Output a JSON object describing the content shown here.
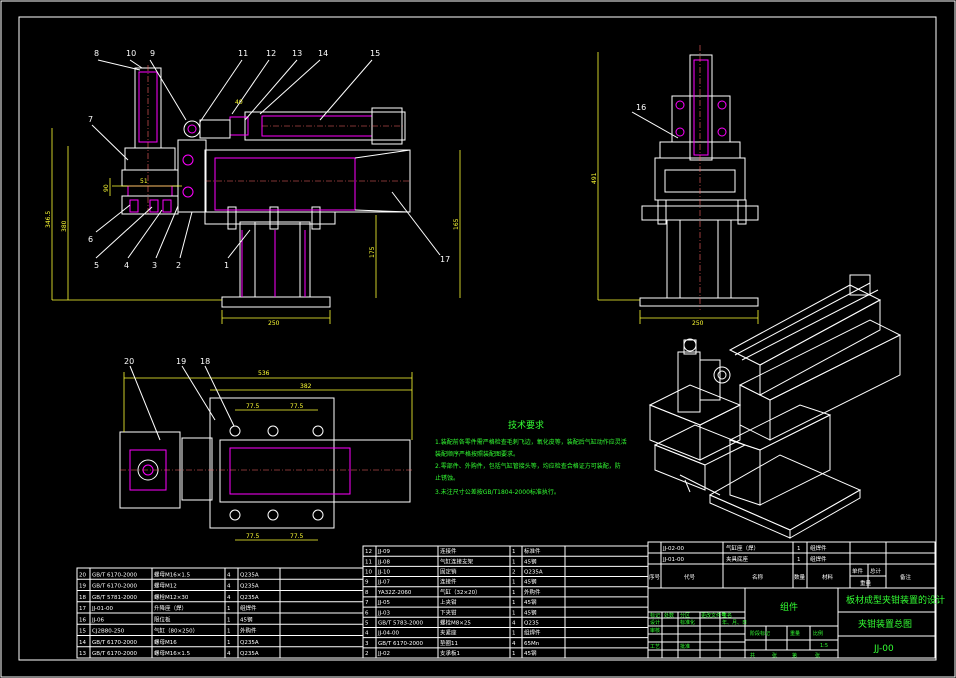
{
  "views": {
    "front": {
      "callouts": [
        "8",
        "10",
        "9",
        "11",
        "12",
        "13",
        "14",
        "15",
        "7",
        "6",
        "5",
        "4",
        "3",
        "2",
        "1",
        "17"
      ],
      "dims": {
        "h_overall": "346.5",
        "h_left": "380",
        "w_small": "90",
        "w_small2": "51",
        "h_right": "175",
        "h_right2": "165",
        "w_base": "250",
        "w_top": "40"
      }
    },
    "side": {
      "callouts": [
        "16"
      ],
      "dims": {
        "h": "491",
        "w": "250"
      }
    },
    "top": {
      "callouts": [
        "20",
        "19",
        "18"
      ],
      "dims": {
        "overall": "536",
        "inner": "382",
        "sp1": "77.5",
        "sp2": "77.5",
        "sp3": "77.5",
        "sp4": "77.5"
      }
    }
  },
  "notes": {
    "title": "技术要求",
    "lines": [
      "1.装配前各零件需严格检查毛刺飞边，氧化皮等，装配后气缸动作应灵活",
      "  装配顺序严格按照装配图要求。",
      "2.零部件、外购件，包括气缸管接头等，均应检查合格证方可装配，防",
      "  止锈蚀。",
      "3.未注尺寸公差按GB/T1804-2000标准执行。"
    ]
  },
  "parts_left": [
    {
      "no": "20",
      "code": "GB/T 6170-2000",
      "name": "螺母M16×1.5",
      "qty": "4",
      "mat": "Q235A"
    },
    {
      "no": "19",
      "code": "GB/T 6170-2000",
      "name": "螺母M12",
      "qty": "4",
      "mat": "Q235A"
    },
    {
      "no": "18",
      "code": "GB/T 5781-2000",
      "name": "螺栓M12×30",
      "qty": "4",
      "mat": "Q235A"
    },
    {
      "no": "17",
      "code": "JJ-01-00",
      "name": "升降座（焊）",
      "qty": "1",
      "mat": "组焊件"
    },
    {
      "no": "16",
      "code": "JJ-06",
      "name": "限位板",
      "qty": "1",
      "mat": "45钢"
    },
    {
      "no": "15",
      "code": "CJ2B80-250",
      "name": "气缸（80×250）",
      "qty": "1",
      "mat": "外购件"
    },
    {
      "no": "14",
      "code": "GB/T 6170-2000",
      "name": "螺母M16",
      "qty": "1",
      "mat": "Q235A"
    },
    {
      "no": "13",
      "code": "GB/T 6170-2000",
      "name": "螺母M16×1.5",
      "qty": "4",
      "mat": "Q235A"
    }
  ],
  "parts_mid": [
    {
      "no": "12",
      "code": "JJ-09",
      "name": "连接件",
      "qty": "1",
      "mat": "标准件"
    },
    {
      "no": "11",
      "code": "JJ-08",
      "name": "气缸连接支架",
      "qty": "1",
      "mat": "45钢"
    },
    {
      "no": "10",
      "code": "JJ-10",
      "name": "固定销",
      "qty": "2",
      "mat": "Q235A"
    },
    {
      "no": "9",
      "code": "JJ-07",
      "name": "连接件",
      "qty": "1",
      "mat": "45钢"
    },
    {
      "no": "8",
      "code": "YA32Z-2060",
      "name": "气缸（32×20）",
      "qty": "1",
      "mat": "外购件"
    },
    {
      "no": "7",
      "code": "JJ-05",
      "name": "上夹钳",
      "qty": "1",
      "mat": "45钢"
    },
    {
      "no": "6",
      "code": "JJ-03",
      "name": "下夹钳",
      "qty": "1",
      "mat": "45钢"
    },
    {
      "no": "5",
      "code": "GB/T 5783-2000",
      "name": "螺栓M8×25",
      "qty": "4",
      "mat": "Q235"
    },
    {
      "no": "4",
      "code": "JJ-04-00",
      "name": "夹紧座",
      "qty": "1",
      "mat": "组焊件"
    },
    {
      "no": "3",
      "code": "GB/T 6170-2000",
      "name": "垫圈11",
      "qty": "4",
      "mat": "65Mn"
    },
    {
      "no": "2",
      "code": "JJ-02",
      "name": "支承板1",
      "qty": "1",
      "mat": "45钢"
    }
  ],
  "title_block": {
    "rev_rows": [
      {
        "code": "JJ-02-00",
        "name": "气缸座（焊）",
        "qty": "1",
        "mat": "组焊件"
      },
      {
        "code": "JJ-01-00",
        "name": "夹具底座",
        "qty": "1",
        "mat": "组焊件"
      }
    ],
    "header": [
      "序号",
      "代号",
      "名称",
      "数量",
      "材料",
      "单件",
      "总计",
      "备注"
    ],
    "header_sub": "重量",
    "design_title": "板材成型夹钳装置的设计",
    "drawing_name": "夹钳装置总图",
    "drawing_no": "JJ-00",
    "assembly": "组件",
    "scale_label": "比例",
    "scale": "1:5",
    "left_labels": [
      "标记",
      "处数",
      "分区",
      "更改文件号",
      "签名",
      "年、月、日",
      "设计",
      "标准化",
      "审核",
      "工艺",
      "批准"
    ],
    "stage_labels": [
      "阶段标记",
      "重量",
      "比例"
    ],
    "sheet": [
      "共",
      "张",
      "第",
      "张"
    ]
  }
}
